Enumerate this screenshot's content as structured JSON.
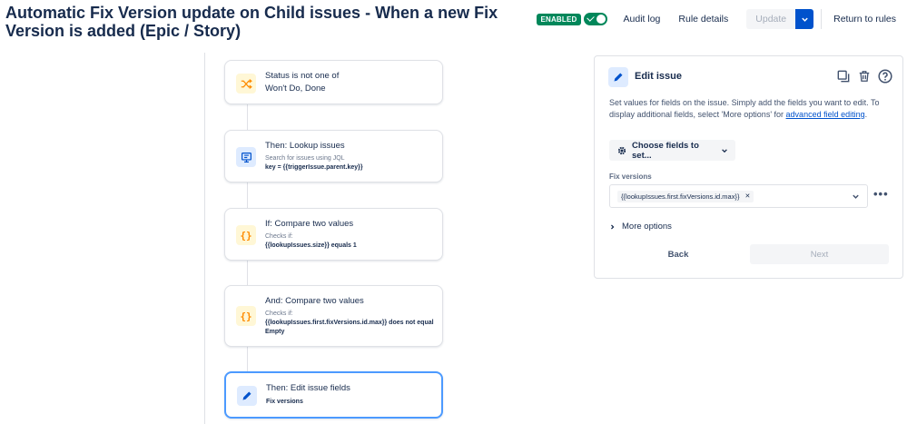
{
  "header": {
    "title": "Automatic Fix Version update on Child issues - When a new Fix Version is added (Epic / Story)",
    "enabled_badge": "ENABLED",
    "audit_log": "Audit log",
    "rule_details": "Rule details",
    "update": "Update",
    "return_to_rules": "Return to rules"
  },
  "flow": {
    "cards": [
      {
        "icon": "shuffle-icon",
        "title": "Status is not one of",
        "line2": "Won't Do, Done"
      },
      {
        "icon": "lookup-issues-icon",
        "title": "Then: Lookup issues",
        "sub": "Search for issues using JQL",
        "bold": "key = {{triggerIssue.parent.key}}"
      },
      {
        "icon": "braces-icon",
        "title": "If: Compare two values",
        "sub": "Checks if:",
        "bold": "{{lookupIssues.size}} equals 1"
      },
      {
        "icon": "braces-icon",
        "title": "And: Compare two values",
        "sub": "Checks if:",
        "bold": "{{lookupIssues.first.fixVersions.id.max}} does not equal Empty"
      },
      {
        "icon": "pencil-icon",
        "title": "Then: Edit issue fields",
        "bold": "Fix versions"
      }
    ]
  },
  "panel": {
    "title": "Edit issue",
    "desc_text": "Set values for fields on the issue. Simply add the fields you want to edit. To display additional fields, select 'More options' for ",
    "desc_link": "advanced field editing",
    "desc_end": ".",
    "choose_fields": "Choose fields to set...",
    "fix_versions_label": "Fix versions",
    "fix_versions_value": "{{lookupIssues.first.fixVersions.id.max}}",
    "more_options": "More options",
    "back": "Back",
    "next": "Next"
  },
  "colors": {
    "accent": "#0052cc",
    "enabled": "#00875a",
    "selected_border": "#4c9aff",
    "icon_yellow_bg": "#fff7d6",
    "icon_blue_bg": "#deebff"
  }
}
